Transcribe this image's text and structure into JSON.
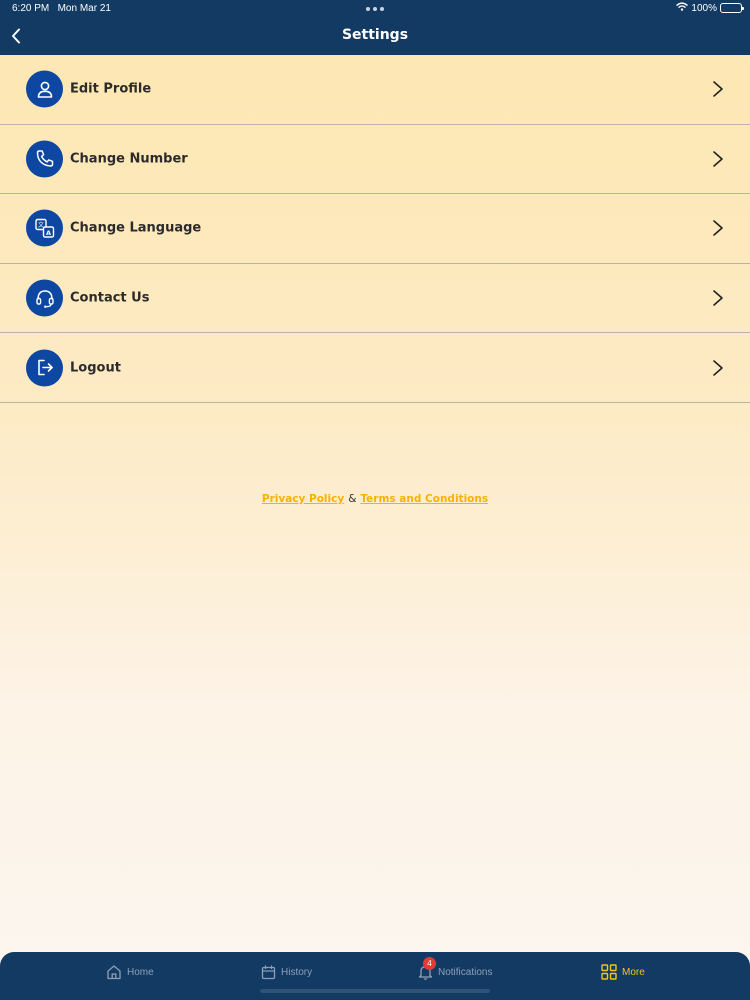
{
  "status_bar": {
    "time": "6:20 PM",
    "date": "Mon Mar 21",
    "battery": "100%"
  },
  "header": {
    "title": "Settings",
    "back_icon": "chevron-left-icon"
  },
  "settings": {
    "items": [
      {
        "label": "Edit Profile",
        "icon": "user-icon"
      },
      {
        "label": "Change Number",
        "icon": "phone-icon"
      },
      {
        "label": "Change Language",
        "icon": "translate-icon"
      },
      {
        "label": "Contact Us",
        "icon": "headset-icon"
      },
      {
        "label": "Logout",
        "icon": "logout-icon"
      }
    ]
  },
  "legal": {
    "privacy": "Privacy Policy",
    "separator": "&",
    "terms": "Terms and Conditions"
  },
  "tabbar": {
    "tabs": [
      {
        "label": "Home",
        "icon": "home-icon",
        "active": false
      },
      {
        "label": "History",
        "icon": "calendar-icon",
        "active": false
      },
      {
        "label": "Notifications",
        "icon": "bell-icon",
        "active": false,
        "badge": "4"
      },
      {
        "label": "More",
        "icon": "grid-icon",
        "active": true
      }
    ]
  },
  "colors": {
    "header_bg": "#123a63",
    "icon_circle": "#0d47a1",
    "accent": "#f5c518",
    "link": "#f2b400",
    "badge": "#e53935"
  }
}
